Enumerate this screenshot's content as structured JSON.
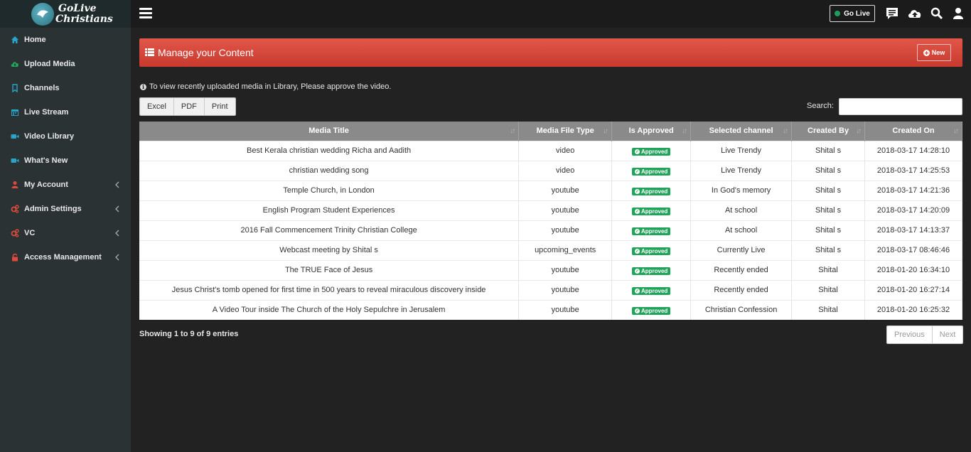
{
  "brand": {
    "line1": "GoLive",
    "line2": "Christians"
  },
  "topbar": {
    "go_live_label": "Go Live",
    "icons": [
      "menu-icon",
      "chat-icon",
      "cloud-upload-icon",
      "search-icon",
      "user-icon"
    ]
  },
  "sidebar": {
    "items": [
      {
        "label": "Home",
        "icon": "home-icon",
        "color": "#2aa3c9"
      },
      {
        "label": "Upload Media",
        "icon": "cloud-upload-icon",
        "color": "#1eaa5a"
      },
      {
        "label": "Channels",
        "icon": "bookmark-icon",
        "color": "#2aa3c9"
      },
      {
        "label": "Live Stream",
        "icon": "calendar-icon",
        "color": "#2aa3c9"
      },
      {
        "label": "Video Library",
        "icon": "video-icon",
        "color": "#2aa3c9"
      },
      {
        "label": "What's New",
        "icon": "video-icon",
        "color": "#2aa3c9"
      },
      {
        "label": "My Account",
        "icon": "user-icon",
        "color": "#e04a3c"
      },
      {
        "label": "Admin Settings",
        "icon": "cogs-icon",
        "color": "#e04a3c"
      },
      {
        "label": "VC",
        "icon": "cogs-icon",
        "color": "#e04a3c"
      },
      {
        "label": "Access Management",
        "icon": "lock-icon",
        "color": "#e04a3c"
      }
    ]
  },
  "panel": {
    "title": "Manage your Content",
    "new_label": "New"
  },
  "notice": "To view recently uploaded media in Library, Please approve the video.",
  "export_buttons": [
    "Excel",
    "PDF",
    "Print"
  ],
  "search": {
    "label": "Search:",
    "value": ""
  },
  "table": {
    "columns": [
      "Media Title",
      "Media File Type",
      "Is Approved",
      "Selected channel",
      "Created By",
      "Created On"
    ],
    "rows": [
      [
        "Best Kerala christian wedding Richa and Aadith",
        "video",
        "Approved",
        "Live Trendy",
        "Shital s",
        "2018-03-17 14:28:10"
      ],
      [
        "christian wedding song",
        "video",
        "Approved",
        "Live Trendy",
        "Shital s",
        "2018-03-17 14:25:53"
      ],
      [
        "Temple Church, in London",
        "youtube",
        "Approved",
        "In God's memory",
        "Shital s",
        "2018-03-17 14:21:36"
      ],
      [
        "English Program Student Experiences",
        "youtube",
        "Approved",
        "At school",
        "Shital s",
        "2018-03-17 14:20:09"
      ],
      [
        "2016 Fall Commencement Trinity Christian College",
        "youtube",
        "Approved",
        "At school",
        "Shital s",
        "2018-03-17 14:13:37"
      ],
      [
        "Webcast meeting by Shital s",
        "upcoming_events",
        "Approved",
        "Currently Live",
        "Shital s",
        "2018-03-17 08:46:46"
      ],
      [
        "The TRUE Face of Jesus",
        "youtube",
        "Approved",
        "Recently ended",
        "Shital",
        "2018-01-20 16:34:10"
      ],
      [
        "Jesus Christ's tomb opened for first time in 500 years to reveal miraculous discovery inside",
        "youtube",
        "Approved",
        "Recently ended",
        "Shital",
        "2018-01-20 16:27:14"
      ],
      [
        "A Video Tour inside The Church of the Holy Sepulchre in Jerusalem",
        "youtube",
        "Approved",
        "Christian Confession",
        "Shital",
        "2018-01-20 16:25:32"
      ]
    ]
  },
  "footer": {
    "showing": "Showing 1 to 9 of 9 entries",
    "prev_label": "Previous",
    "next_label": "Next"
  }
}
